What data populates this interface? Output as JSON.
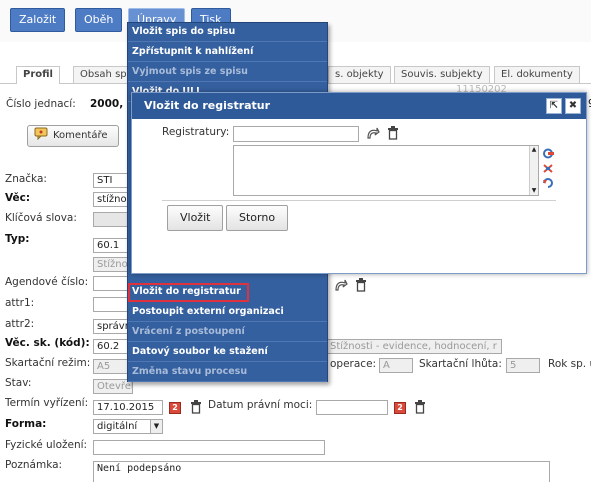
{
  "toolbar": {
    "zalozit": "Založit",
    "obeh": "Oběh",
    "upravy": "Úpravy",
    "tisk": "Tisk"
  },
  "tabs": {
    "profil": "Profil",
    "obsah": "Obsah spi",
    "souvis_objekty": "s. objekty",
    "souvis_subjekty": "Souvis. subjekty",
    "el_dokumenty": "El. dokumenty"
  },
  "faint_number": "11150202",
  "header": {
    "cislo_label": "Číslo jednací:",
    "cislo_value": "2000,",
    "cislo_tail": "9"
  },
  "komentare": "Komentáře",
  "form": {
    "znacka_label": "Značka:",
    "znacka_value": "STI",
    "vec_label": "Věc:",
    "vec_value": "stížnos",
    "klic_label": "Klíčová slova:",
    "typ_label": "Typ:",
    "typ_value": "60.1",
    "typ_sub": "Stížno",
    "agendove_label": "Agendové číslo:",
    "attr1_label": "attr1:",
    "attr2_label": "attr2:",
    "attr2_value": "správn",
    "vecsk_label": "Věc. sk. (kód):",
    "vecsk_value": "60.2",
    "vecsk_desc": "Stížnosti - evidence, hodnocení, r",
    "skartacni_label": "Skartační režim:",
    "skartacni_value": "A5",
    "operace_label": "operace:",
    "operace_value": "A",
    "lhuta_label": "Skartační lhůta:",
    "lhuta_value": "5",
    "rok_label": "Rok sp. u",
    "stav_label": "Stav:",
    "stav_value": "Otevřen",
    "termin_label": "Termín vyřízení:",
    "termin_value": "17.10.2015",
    "pravni_label": "Datum právní moci:",
    "forma_label": "Forma:",
    "forma_value": "digitální",
    "fyzicke_label": "Fyzické uložení:",
    "poznamka_label": "Poznámka:",
    "poznamka_value": "Není podepsáno"
  },
  "menu": {
    "items": [
      "Vložit spis do spisu",
      "Zpřístupnit k nahlížení",
      "Vyjmout spis ze spisu",
      "Vložit do ULL",
      "Vložit do registratur",
      "Postoupit externí organizaci",
      "Vrácení z postoupení",
      "Datový soubor ke stažení",
      "Změna stavu procesu"
    ]
  },
  "modal": {
    "title": "Vložit do registratur",
    "registratury_label": "Registratury:",
    "vlozit": "Vložit",
    "storno": "Storno"
  },
  "colors": {
    "accent": "#2e5a9a",
    "menu_bg": "#35609f",
    "highlight": "#e0313f"
  }
}
